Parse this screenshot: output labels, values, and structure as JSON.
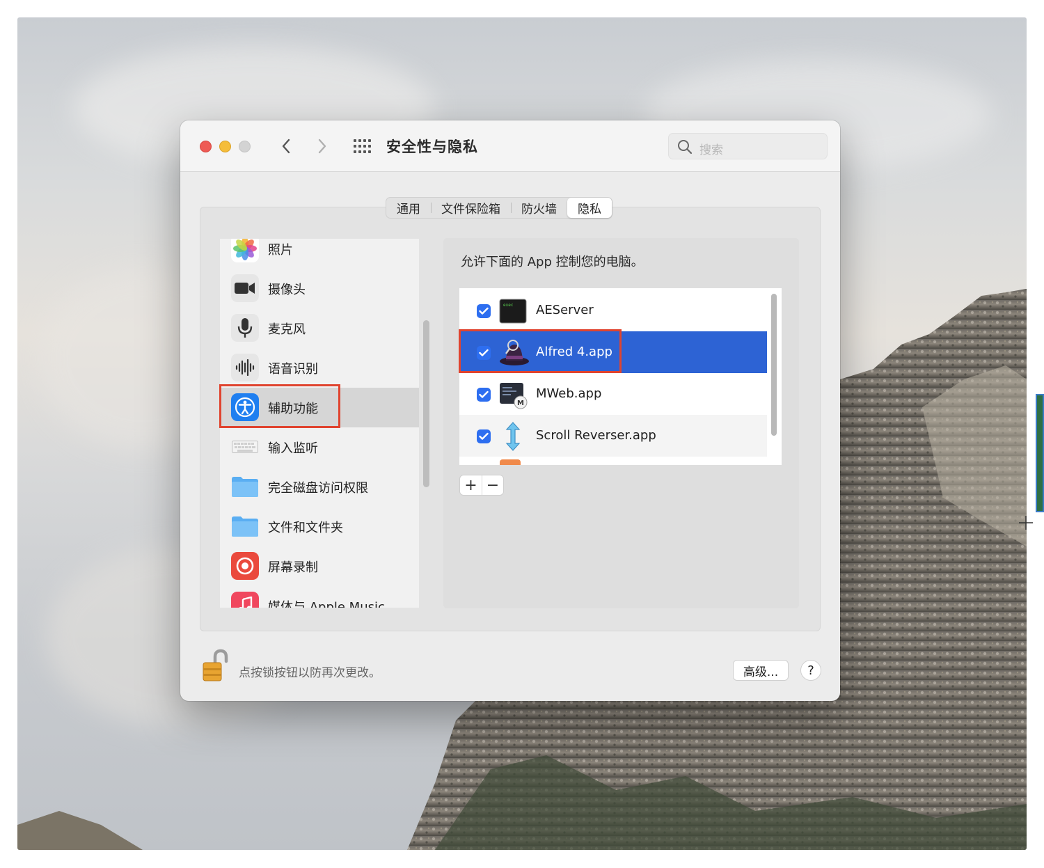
{
  "window": {
    "title": "安全性与隐私",
    "search_placeholder": "搜索"
  },
  "tabs": [
    {
      "label": "通用",
      "active": false
    },
    {
      "label": "文件保险箱",
      "active": false
    },
    {
      "label": "防火墙",
      "active": false
    },
    {
      "label": "隐私",
      "active": true
    }
  ],
  "sidebar": {
    "items": [
      {
        "label": "照片",
        "icon": "photos-icon"
      },
      {
        "label": "摄像头",
        "icon": "camera-icon"
      },
      {
        "label": "麦克风",
        "icon": "microphone-icon"
      },
      {
        "label": "语音识别",
        "icon": "speech-recognition-icon"
      },
      {
        "label": "辅助功能",
        "icon": "accessibility-icon",
        "selected": true
      },
      {
        "label": "输入监听",
        "icon": "keyboard-icon"
      },
      {
        "label": "完全磁盘访问权限",
        "icon": "folder-icon"
      },
      {
        "label": "文件和文件夹",
        "icon": "folder-icon"
      },
      {
        "label": "屏幕录制",
        "icon": "screen-recording-icon"
      },
      {
        "label": "媒体与 Apple Music",
        "icon": "music-icon"
      }
    ]
  },
  "right_pane": {
    "heading": "允许下面的 App 控制您的电脑。",
    "apps": [
      {
        "name": "AEServer",
        "checked": true,
        "icon": "terminal-exec-icon"
      },
      {
        "name": "Alfred 4.app",
        "checked": true,
        "icon": "alfred-hat-icon",
        "selected": true
      },
      {
        "name": "MWeb.app",
        "checked": true,
        "icon": "mweb-icon"
      },
      {
        "name": "Scroll Reverser.app",
        "checked": true,
        "icon": "scroll-reverser-icon"
      }
    ],
    "add_label": "+",
    "remove_label": "−"
  },
  "footer": {
    "lock_text": "点按锁按钮以防再次更改。",
    "advanced_label": "高级...",
    "help_label": "?"
  },
  "colors": {
    "selection_blue": "#2d63d4",
    "checkbox_blue": "#2d6ef0",
    "highlight_red": "#e0442f",
    "close": "#ee5b55",
    "minimize": "#f5bd3a"
  }
}
